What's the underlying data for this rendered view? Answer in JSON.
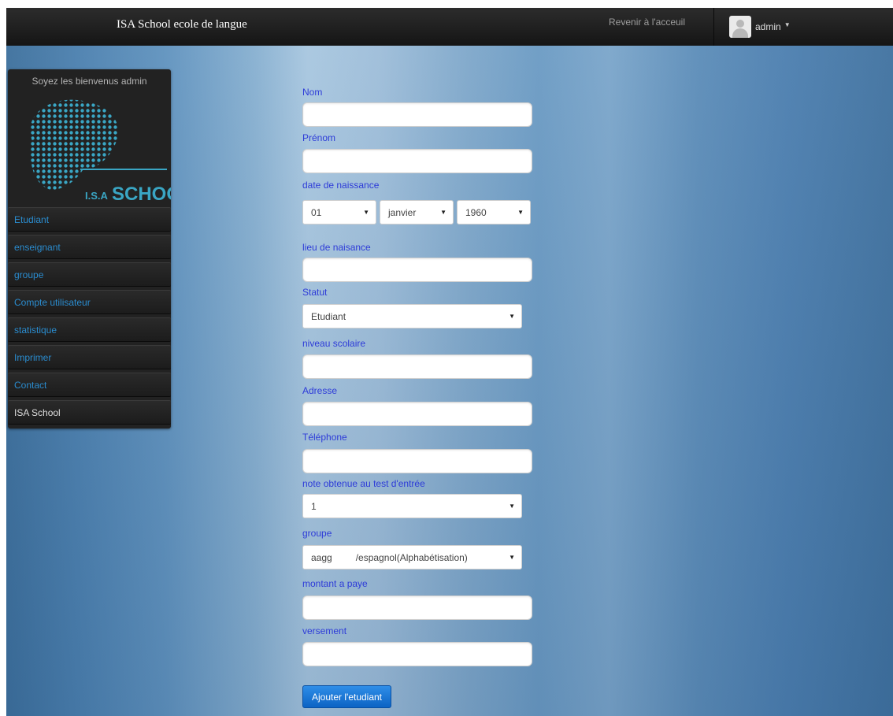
{
  "header": {
    "brand": "ISA School ecole de langue",
    "home_link": "Revenir à l'acceuil",
    "user_name": "admin"
  },
  "sidebar": {
    "welcome": "Soyez les bienvenus   admin",
    "logo_text": "I.S.A SCHOOL",
    "items": [
      {
        "label": "Etudiant"
      },
      {
        "label": "enseignant"
      },
      {
        "label": "groupe"
      },
      {
        "label": "Compte utilisateur"
      },
      {
        "label": "statistique"
      },
      {
        "label": "Imprimer"
      },
      {
        "label": "Contact"
      },
      {
        "label": "ISA School"
      }
    ],
    "accent_color": "#2a8ccf"
  },
  "form": {
    "nom_label": "Nom",
    "prenom_label": "Prénom",
    "birth_label": "date de naissance",
    "birth_day": "01",
    "birth_month": "janvier",
    "birth_year": "1960",
    "lieu_label": "lieu de naisance",
    "statut_label": "Statut",
    "statut_value": "Etudiant",
    "niveau_label": "niveau scolaire",
    "adresse_label": "Adresse",
    "telephone_label": "Téléphone",
    "note_label": "note obtenue au test d'entrée",
    "note_value": "1",
    "groupe_label": "groupe",
    "groupe_value": "aagg         /espagnol(Alphabétisation)",
    "montant_label": "montant a paye",
    "versement_label": "versement",
    "submit_label": "Ajouter l'etudiant",
    "label_color": "#2d3bd8"
  }
}
